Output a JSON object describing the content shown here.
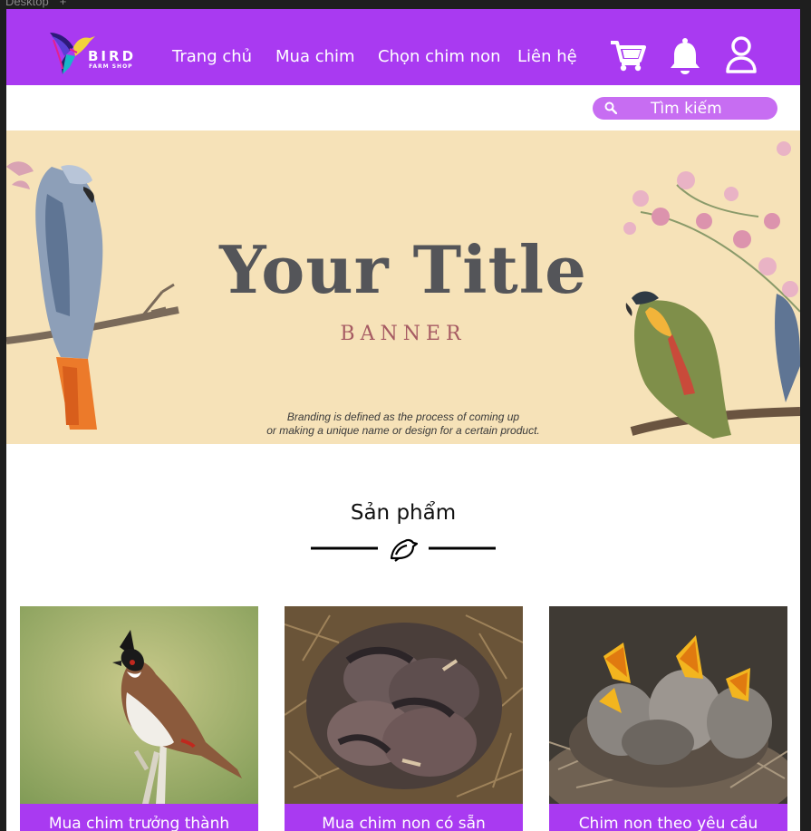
{
  "frame": {
    "label": "Desktop",
    "label_icon": "plus-icon"
  },
  "brand": {
    "name": "BIRD",
    "tagline": "FARM SHOP",
    "accent": "#a93af1",
    "search_bg": "#c76df2"
  },
  "nav": {
    "items": [
      {
        "label": "Trang chủ"
      },
      {
        "label": "Mua chim"
      },
      {
        "label": "Chọn chim non"
      },
      {
        "label": "Liên hệ"
      }
    ],
    "icons": [
      "cart-icon",
      "bell-icon",
      "user-icon"
    ]
  },
  "search": {
    "placeholder": "Tìm kiếm",
    "icon": "search-icon"
  },
  "banner": {
    "title": "Your Title",
    "subtitle": "BANNER",
    "desc_line1": "Branding is defined as the process of coming up",
    "desc_line2": "or making a unique name or design for a certain product."
  },
  "products": {
    "section_title": "Sản phẩm",
    "divider_icon": "bird-icon",
    "cards": [
      {
        "label": "Mua chim trưởng thành",
        "image": "adult-bulbul-bird"
      },
      {
        "label": "Mua chim non có sẵn",
        "image": "sleeping-chicks-nest"
      },
      {
        "label": "Chim non theo yêu cầu",
        "image": "chicks-open-beaks-nest"
      }
    ]
  }
}
